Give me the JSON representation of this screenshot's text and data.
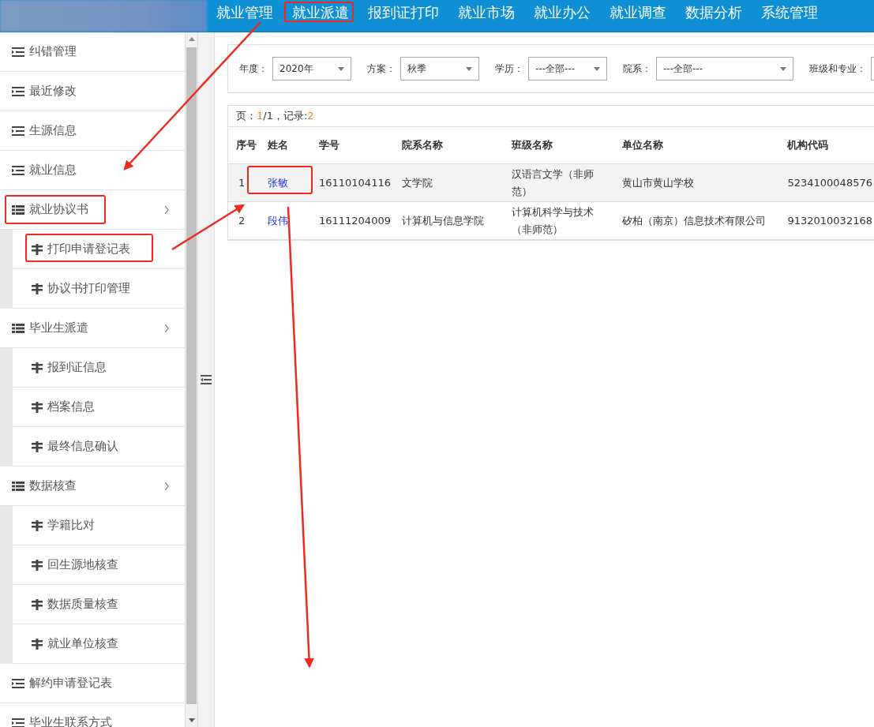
{
  "top_nav": {
    "items": [
      "就业管理",
      "就业派遣",
      "报到证打印",
      "就业市场",
      "就业办公",
      "就业调查",
      "数据分析",
      "系统管理"
    ]
  },
  "sidebar": {
    "items": [
      {
        "kind": "link",
        "label": "纠错管理"
      },
      {
        "kind": "link",
        "label": "最近修改"
      },
      {
        "kind": "link",
        "label": "生源信息"
      },
      {
        "kind": "link",
        "label": "就业信息"
      },
      {
        "kind": "group",
        "label": "就业协议书",
        "children": [
          {
            "label": "打印申请登记表"
          },
          {
            "label": "协议书打印管理"
          }
        ]
      },
      {
        "kind": "group",
        "label": "毕业生派遣",
        "children": [
          {
            "label": "报到证信息"
          },
          {
            "label": "档案信息"
          },
          {
            "label": "最终信息确认"
          }
        ]
      },
      {
        "kind": "group",
        "label": "数据核查",
        "children": [
          {
            "label": "学籍比对"
          },
          {
            "label": "回生源地核查"
          },
          {
            "label": "数据质量核查"
          },
          {
            "label": "就业单位核查"
          }
        ]
      },
      {
        "kind": "link",
        "label": "解约申请登记表"
      },
      {
        "kind": "link",
        "label": "毕业生联系方式"
      }
    ]
  },
  "filters": [
    {
      "kind": "select",
      "label": "年度：",
      "value": "2020年"
    },
    {
      "kind": "select",
      "label": "方案：",
      "value": "秋季"
    },
    {
      "kind": "select",
      "label": "学历：",
      "value": "---全部---"
    },
    {
      "kind": "select",
      "label": "院系：",
      "value": "---全部---",
      "wide": true
    },
    {
      "kind": "input",
      "label": "班级和专业："
    }
  ],
  "pager": {
    "page_label": "页：",
    "page": "1",
    "pages": "/1",
    "records_label": "，记录:",
    "records": "2"
  },
  "table": {
    "columns": [
      "序号",
      "姓名",
      "学号",
      "院系名称",
      "班级名称",
      "单位名称",
      "机构代码"
    ],
    "rows": [
      {
        "highlighted": true,
        "cells": [
          "1",
          "张敏",
          "16110104116",
          "文学院",
          "汉语言文学（非师范）",
          "黄山市黄山学校",
          "5234100048576"
        ]
      },
      {
        "highlighted": false,
        "cells": [
          "2",
          "段伟",
          "16111204009",
          "计算机与信息学院",
          "计算机科学与技术（非师范）",
          "矽柏（南京）信息技术有限公司",
          "9132010032168"
        ]
      }
    ]
  }
}
